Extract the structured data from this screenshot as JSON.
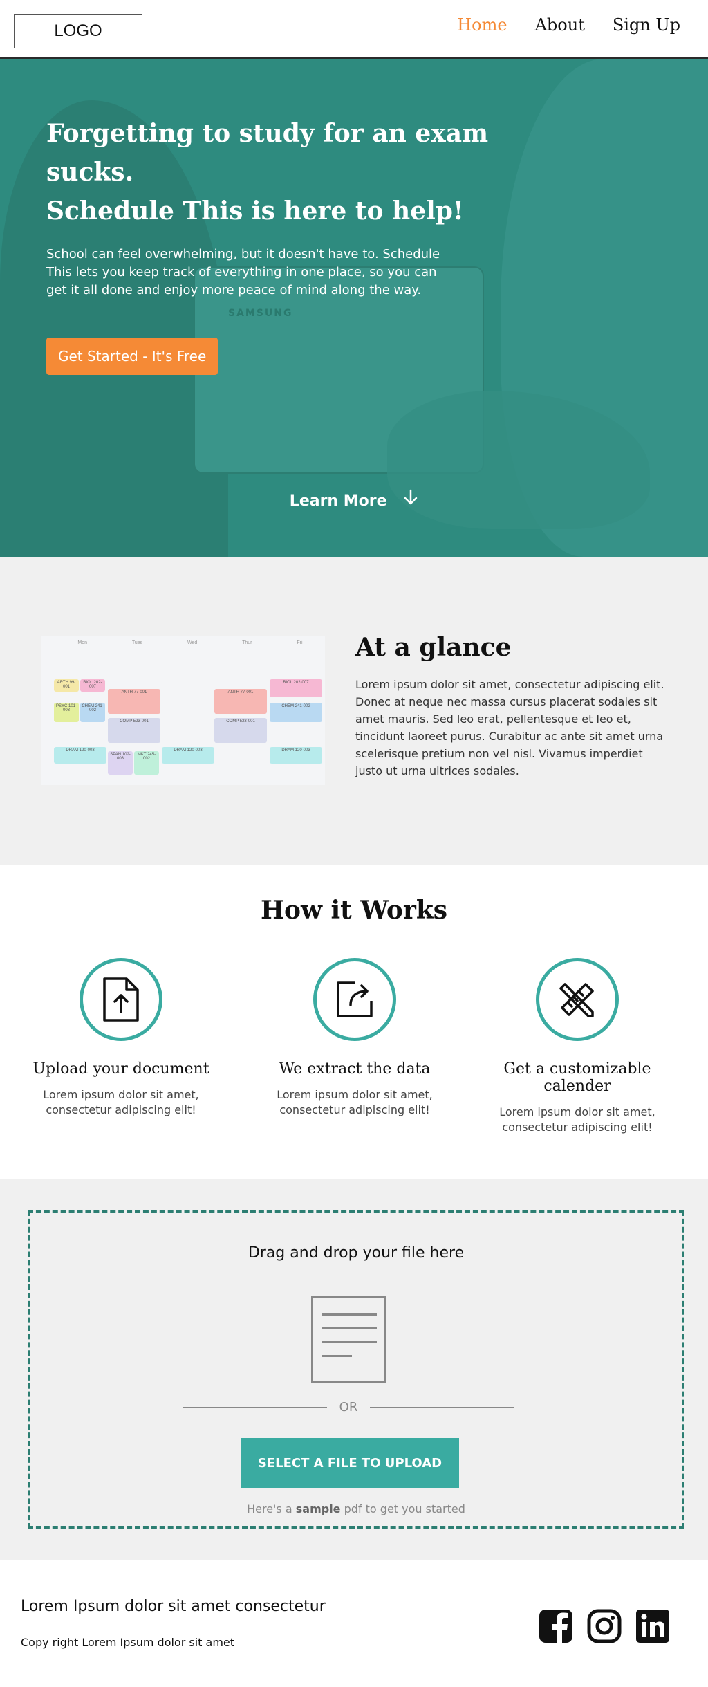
{
  "nav": {
    "logo": "LOGO",
    "links": [
      "Home",
      "About",
      "Sign Up"
    ]
  },
  "hero": {
    "title_line1": "Forgetting to study for an exam sucks.",
    "title_line2": "Schedule This is here to help!",
    "text": "School can feel overwhelming, but it doesn't have to. Schedule This lets you keep track of everything in one place, so you can get it all done and enjoy more peace of mind along the way.",
    "cta": "Get Started - It's Free",
    "laptop_brand": "SAMSUNG",
    "learn_more": "Learn More"
  },
  "glance": {
    "title": "At a glance",
    "body": "Lorem ipsum dolor sit amet, consectetur adipiscing elit. Donec at neque nec massa cursus placerat sodales sit amet mauris. Sed leo erat, pellentesque et leo et, tincidunt laoreet purus. Curabitur ac ante sit amet urna scelerisque pretium non vel nisl. Vivamus imperdiet justo ut urna ultrices sodales.",
    "calendar": {
      "days": [
        "Mon",
        "Tues",
        "Wed",
        "Thur",
        "Fri"
      ],
      "events": [
        "ARTH 99-001",
        "BIOL 202-007",
        "ANTH 77-001",
        "ANTH 77-001",
        "BIOL 202-007",
        "PSYC 101-003",
        "CHEM 241-002",
        "CHEM 241-002",
        "COMP 523-001",
        "COMP 523-001",
        "DRAM 120-003",
        "DRAM 120-003",
        "DRAM 120-003",
        "SPAN 102-003",
        "MKT 245-002"
      ]
    }
  },
  "how": {
    "title": "How it Works",
    "steps": [
      {
        "title": "Upload your document",
        "text": "Lorem ipsum dolor sit amet, consectetur adipiscing elit!"
      },
      {
        "title": "We extract the  data",
        "text": "Lorem ipsum dolor sit amet, consectetur adipiscing elit!"
      },
      {
        "title": "Get a customizable calender",
        "text": "Lorem ipsum dolor sit amet, consectetur adipiscing elit!"
      }
    ]
  },
  "upload": {
    "title": "Drag and drop your file here",
    "or": "OR",
    "button": "SELECT A FILE TO UPLOAD",
    "note_prefix": "Here's a ",
    "note_bold": "sample",
    "note_suffix": " pdf to get you started"
  },
  "footer": {
    "title": "Lorem Ipsum dolor sit amet consectetur",
    "copyright": "Copy right Lorem Ipsum dolor sit amet"
  },
  "colors": {
    "accent_orange": "#f58a36",
    "teal": "#3aaba1",
    "hero_teal": "#2e8b7f",
    "dropzone_border": "#2c7e72"
  },
  "icons": [
    "upload-document-icon",
    "share-export-icon",
    "ruler-pencil-icon",
    "document-icon",
    "arrow-down-icon",
    "facebook-icon",
    "instagram-icon",
    "linkedin-icon"
  ]
}
